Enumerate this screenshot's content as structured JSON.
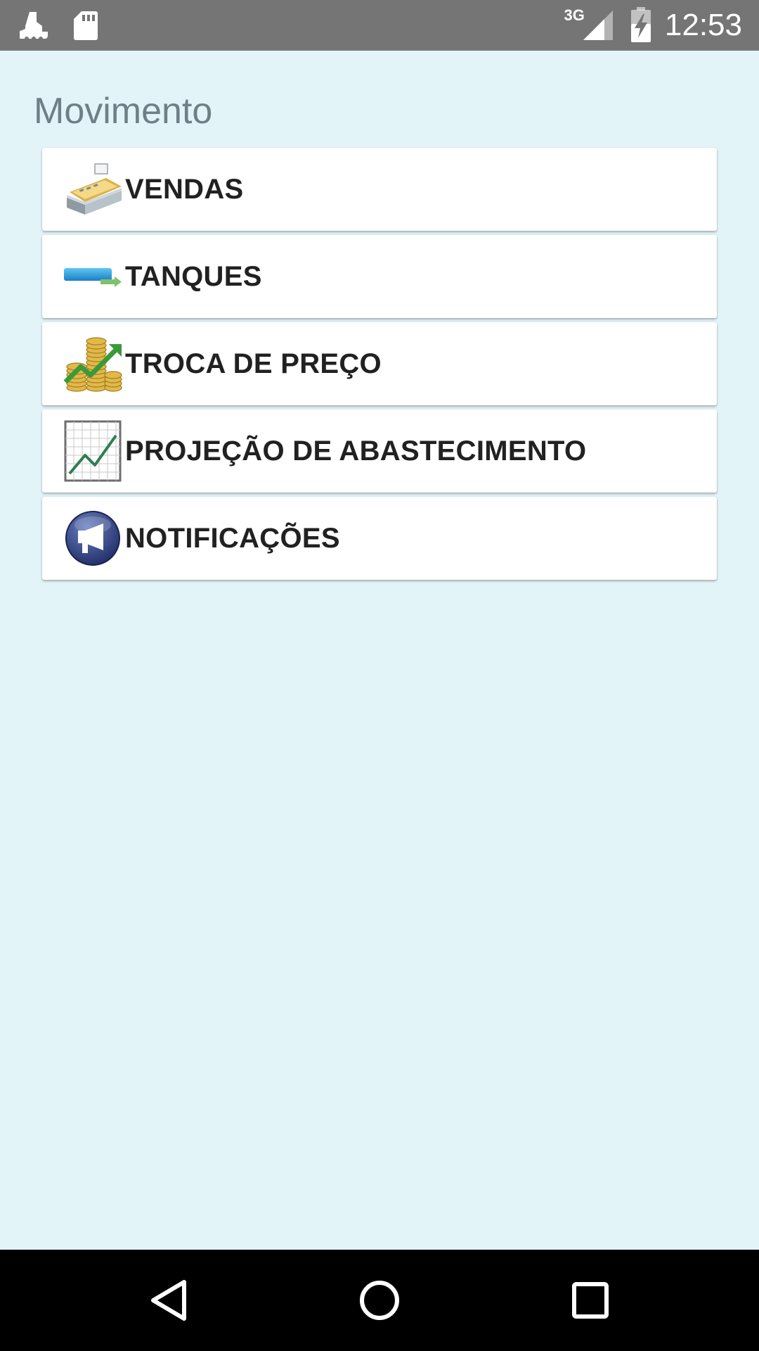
{
  "status_bar": {
    "left_icons": [
      "notification-icon",
      "sd-card-icon"
    ],
    "network_type": "3G",
    "signal_icon": "cell-signal-icon",
    "battery_icon": "battery-charging-icon",
    "time": "12:53"
  },
  "page": {
    "title": "Movimento",
    "background_color": "#e3f4f9"
  },
  "menu": {
    "items": [
      {
        "label": "VENDAS",
        "icon": "cash-register-icon"
      },
      {
        "label": "TANQUES",
        "icon": "tank-icon"
      },
      {
        "label": "TROCA DE PREÇO",
        "icon": "coins-chart-icon"
      },
      {
        "label": "PROJEÇÃO DE ABASTECIMENTO",
        "icon": "line-chart-icon"
      },
      {
        "label": "NOTIFICAÇÕES",
        "icon": "megaphone-icon"
      }
    ]
  },
  "nav_bar": {
    "buttons": [
      "back",
      "home",
      "recents"
    ]
  }
}
